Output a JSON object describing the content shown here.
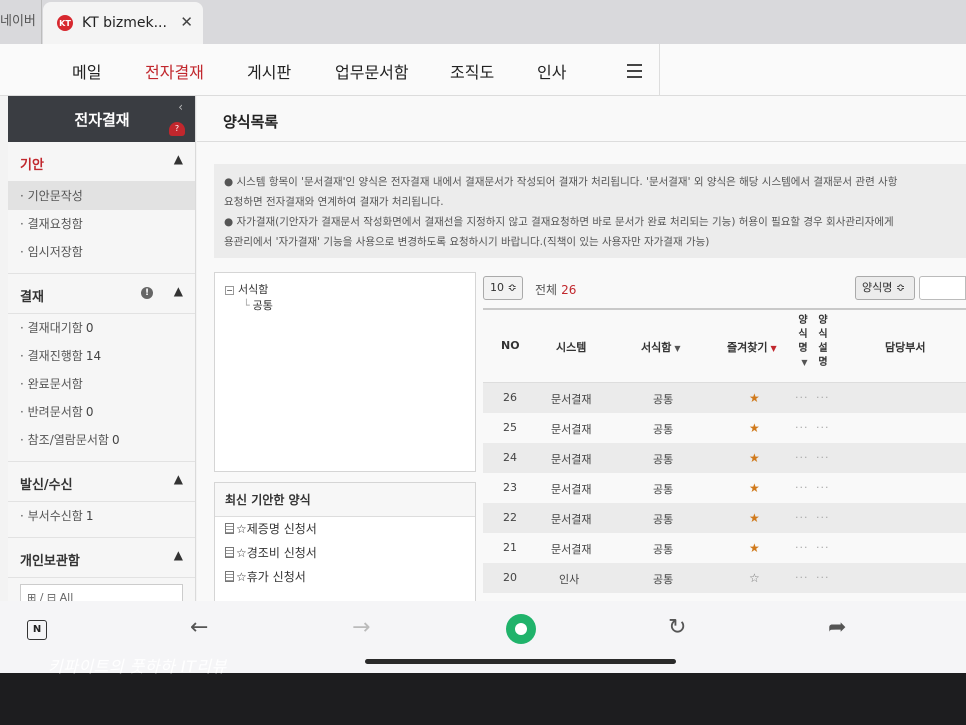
{
  "browser": {
    "prev_tab_label": "네이버",
    "active_tab": {
      "favicon": "kt-icon",
      "title": "KT bizmek...",
      "close_icon": "close-icon"
    }
  },
  "topnav": {
    "items": [
      "메일",
      "전자결재",
      "게시판",
      "업무문서함",
      "조직도",
      "인사"
    ],
    "active": "전자결재",
    "menu_icon": "hamburger-icon",
    "accent_color": "#c1272d"
  },
  "sidebar": {
    "title": "전자결재",
    "collapse_icon": "chevron-left-icon",
    "help_icon": "headset-icon",
    "sections": [
      {
        "title": "기안",
        "items": [
          {
            "label": "기안문작성"
          },
          {
            "label": "결재요청함"
          },
          {
            "label": "임시저장함"
          }
        ]
      },
      {
        "title": "결재",
        "items": [
          {
            "label": "결재대기함",
            "count": "0"
          },
          {
            "label": "결재진행함",
            "count": "14"
          },
          {
            "label": "완료문서함"
          },
          {
            "label": "반려문서함",
            "count": "0"
          },
          {
            "label": "참조/열람문서함",
            "count": "0"
          }
        ]
      },
      {
        "title": "발신/수신",
        "items": [
          {
            "label": "부서수신함",
            "count": "1"
          }
        ]
      },
      {
        "title": "개인보관함",
        "box": "⊞ / ⊟ All"
      }
    ]
  },
  "main": {
    "title": "양식목록",
    "notice": [
      "● 시스템 항목이 '문서결재'인 양식은 전자결재 내에서 결재문서가 작성되어 결재가 처리됩니다. '문서결재' 외 양식은 해당 시스템에서 결재문서 관련 사항",
      "요청하면 전자결재와 연계하여 결재가 처리됩니다.",
      "● 자가결재(기안자가 결재문서 작성화면에서 결재선을 지정하지 않고 결재요청하면 바로 문서가 완료 처리되는 기능) 허용이 필요할 경우 회사관리자에게",
      "용관리에서 '자가결재' 기능을 사용으로 변경하도록 요청하시기 바랍니다.(직책이 있는 사용자만 자가결재 가능)"
    ],
    "tree": {
      "root": "서식함",
      "child": "공통"
    },
    "recent": {
      "title": "최신 기안한 양식",
      "items": [
        "☆제증명 신청서",
        "☆경조비 신청서",
        "☆휴가 신청서"
      ]
    },
    "toolbar": {
      "page_size": "10 ≎",
      "total_label": "전체",
      "total_count": "26",
      "search_field": "양식명 ≎"
    },
    "grid": {
      "headers": {
        "no": "NO",
        "system": "시스템",
        "folder": "서식함",
        "favorite": "즐겨찾기",
        "form_name": "양식명",
        "form_desc": "양식설명",
        "dept": "담당부서"
      },
      "rows": [
        {
          "no": "26",
          "system": "문서결재",
          "folder": "공통",
          "fav": "★",
          "name": "···",
          "desc": "···"
        },
        {
          "no": "25",
          "system": "문서결재",
          "folder": "공통",
          "fav": "★",
          "name": "···",
          "desc": "···"
        },
        {
          "no": "24",
          "system": "문서결재",
          "folder": "공통",
          "fav": "★",
          "name": "···",
          "desc": "···"
        },
        {
          "no": "23",
          "system": "문서결재",
          "folder": "공통",
          "fav": "★",
          "name": "···",
          "desc": "···"
        },
        {
          "no": "22",
          "system": "문서결재",
          "folder": "공통",
          "fav": "★",
          "name": "···",
          "desc": "···"
        },
        {
          "no": "21",
          "system": "문서결재",
          "folder": "공통",
          "fav": "★",
          "name": "···",
          "desc": "···"
        },
        {
          "no": "20",
          "system": "인사",
          "folder": "공통",
          "fav": "☆",
          "name": "···",
          "desc": "···"
        }
      ]
    }
  },
  "bottom_bar": {
    "note_icon": "N",
    "back_icon": "←",
    "forward_icon": "→",
    "home_icon": "home-icon",
    "reload_icon": "↻",
    "share_icon": "share-icon"
  },
  "watermark": "키파이트의 풋하하 IT리뷰"
}
